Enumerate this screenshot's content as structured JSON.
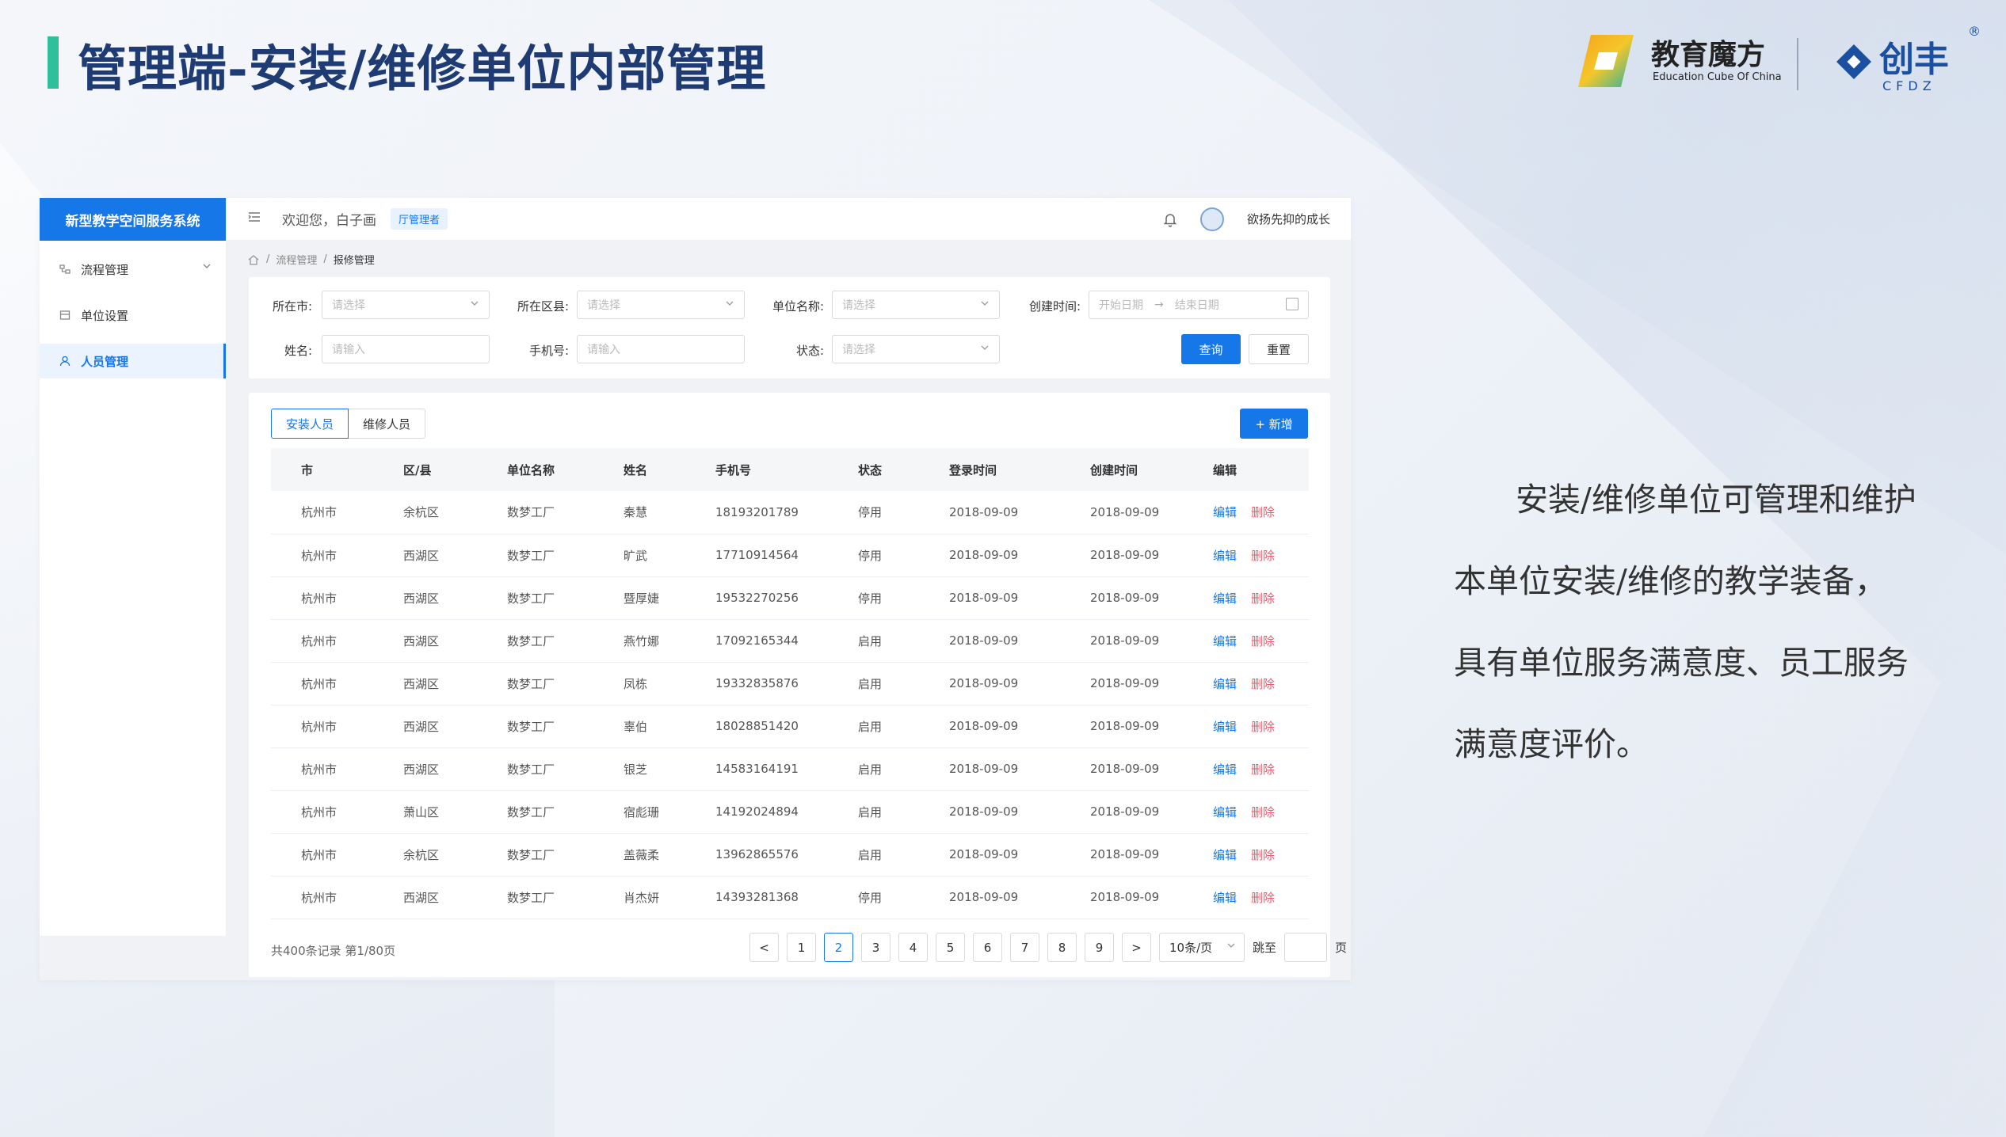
{
  "slide": {
    "title": "管理端-安装/维修单位内部管理",
    "description_lines": [
      "安装/维修单位可管理和维护",
      "本单位安装/维修的教学装备，",
      "具有单位服务满意度、员工服务",
      "满意度评价。"
    ]
  },
  "logos": {
    "edu_name": "教育魔方",
    "edu_sub": "Education Cube Of China",
    "cfdz_name": "创丰",
    "cfdz_sub": "CFDZ",
    "reg_mark": "®"
  },
  "app": {
    "brand": "新型教学空间服务系统",
    "sidebar": {
      "items": [
        {
          "label": "流程管理",
          "icon": "flow-icon",
          "active": false,
          "expandable": true
        },
        {
          "label": "单位设置",
          "icon": "unit-icon",
          "active": false
        },
        {
          "label": "人员管理",
          "icon": "user-icon",
          "active": true
        }
      ]
    },
    "topbar": {
      "welcome": "欢迎您，白子画",
      "role": "厅管理者",
      "username": "欲扬先抑的成长"
    },
    "breadcrumb": {
      "items": [
        "流程管理",
        "报修管理"
      ],
      "separator": "/"
    },
    "filters": {
      "city_label": "所在市:",
      "city_placeholder": "请选择",
      "district_label": "所在区县:",
      "district_placeholder": "请选择",
      "unit_label": "单位名称:",
      "unit_placeholder": "请选择",
      "created_label": "创建时间:",
      "start_placeholder": "开始日期",
      "end_placeholder": "结束日期",
      "date_sep": "→",
      "name_label": "姓名:",
      "name_placeholder": "请输入",
      "phone_label": "手机号:",
      "phone_placeholder": "请输入",
      "status_label": "状态:",
      "status_placeholder": "请选择",
      "query_button": "查询",
      "reset_button": "重置"
    },
    "tabs": [
      "安装人员",
      "维修人员"
    ],
    "add_button": "+ 新增",
    "table": {
      "columns": [
        "市",
        "区/县",
        "单位名称",
        "姓名",
        "手机号",
        "状态",
        "登录时间",
        "创建时间",
        "编辑"
      ],
      "edit_label": "编辑",
      "delete_label": "删除",
      "rows": [
        [
          "杭州市",
          "余杭区",
          "数梦工厂",
          "秦慧",
          "18193201789",
          "停用",
          "2018-09-09",
          "2018-09-09"
        ],
        [
          "杭州市",
          "西湖区",
          "数梦工厂",
          "旷武",
          "17710914564",
          "停用",
          "2018-09-09",
          "2018-09-09"
        ],
        [
          "杭州市",
          "西湖区",
          "数梦工厂",
          "暨厚婕",
          "19532270256",
          "停用",
          "2018-09-09",
          "2018-09-09"
        ],
        [
          "杭州市",
          "西湖区",
          "数梦工厂",
          "燕竹娜",
          "17092165344",
          "启用",
          "2018-09-09",
          "2018-09-09"
        ],
        [
          "杭州市",
          "西湖区",
          "数梦工厂",
          "凤栋",
          "19332835876",
          "启用",
          "2018-09-09",
          "2018-09-09"
        ],
        [
          "杭州市",
          "西湖区",
          "数梦工厂",
          "辜伯",
          "18028851420",
          "启用",
          "2018-09-09",
          "2018-09-09"
        ],
        [
          "杭州市",
          "西湖区",
          "数梦工厂",
          "银芝",
          "14583164191",
          "启用",
          "2018-09-09",
          "2018-09-09"
        ],
        [
          "杭州市",
          "萧山区",
          "数梦工厂",
          "宿彪珊",
          "14192024894",
          "启用",
          "2018-09-09",
          "2018-09-09"
        ],
        [
          "杭州市",
          "余杭区",
          "数梦工厂",
          "盖薇柔",
          "13962865576",
          "启用",
          "2018-09-09",
          "2018-09-09"
        ],
        [
          "杭州市",
          "西湖区",
          "数梦工厂",
          "肖杰妍",
          "14393281368",
          "停用",
          "2018-09-09",
          "2018-09-09"
        ]
      ]
    },
    "pagination": {
      "summary": "共400条记录  第1/80页",
      "pages": [
        "1",
        "2",
        "3",
        "4",
        "5",
        "6",
        "7",
        "8",
        "9"
      ],
      "current_page": "2",
      "prev": "<",
      "next": ">",
      "page_size": "10条/页",
      "jump_label": "跳至",
      "jump_suffix": "页"
    }
  },
  "colors": {
    "accent": "#1677e8",
    "title": "#1f3b73",
    "title_bar": "#2fbf9a",
    "delete": "#f0596a"
  }
}
